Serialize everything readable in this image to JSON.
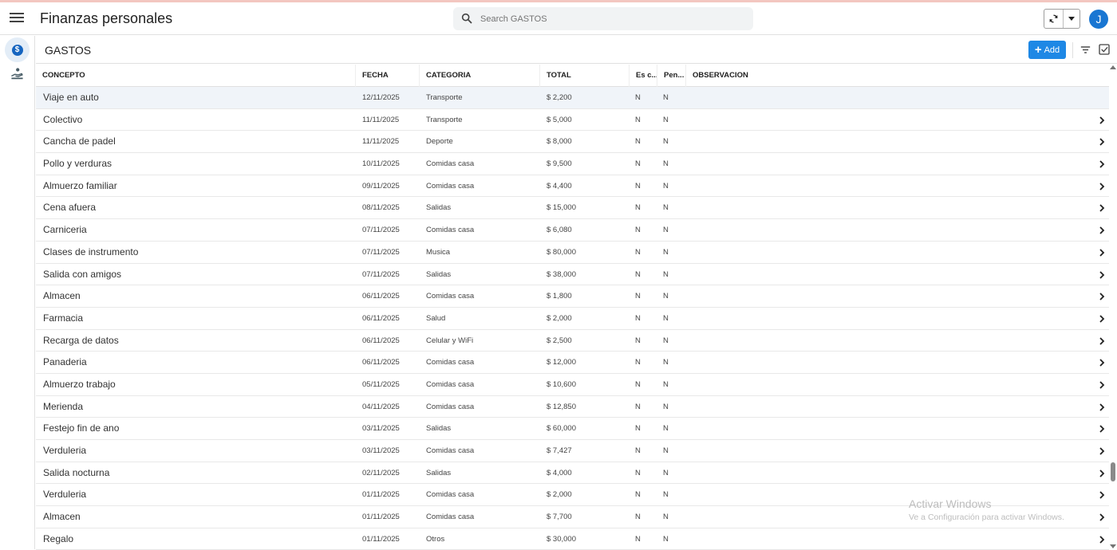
{
  "app": {
    "title": "Finanzas personales",
    "avatar_initial": "J"
  },
  "search": {
    "placeholder": "Search GASTOS"
  },
  "view": {
    "title": "GASTOS",
    "add_label": "Add"
  },
  "columns": [
    "CONCEPTO",
    "FECHA",
    "CATEGORIA",
    "TOTAL",
    "Es c...",
    "Pen...",
    "OBSERVACION"
  ],
  "rows": [
    {
      "concepto": "Viaje en auto",
      "fecha": "12/11/2025",
      "categoria": "Transporte",
      "total": "$ 2,200",
      "es": "N",
      "pen": "N"
    },
    {
      "concepto": "Colectivo",
      "fecha": "11/11/2025",
      "categoria": "Transporte",
      "total": "$ 5,000",
      "es": "N",
      "pen": "N"
    },
    {
      "concepto": "Cancha de padel",
      "fecha": "11/11/2025",
      "categoria": "Deporte",
      "total": "$ 8,000",
      "es": "N",
      "pen": "N"
    },
    {
      "concepto": "Pollo y verduras",
      "fecha": "10/11/2025",
      "categoria": "Comidas casa",
      "total": "$ 9,500",
      "es": "N",
      "pen": "N"
    },
    {
      "concepto": "Almuerzo familiar",
      "fecha": "09/11/2025",
      "categoria": "Comidas casa",
      "total": "$ 4,400",
      "es": "N",
      "pen": "N"
    },
    {
      "concepto": "Cena afuera",
      "fecha": "08/11/2025",
      "categoria": "Salidas",
      "total": "$ 15,000",
      "es": "N",
      "pen": "N"
    },
    {
      "concepto": "Carniceria",
      "fecha": "07/11/2025",
      "categoria": "Comidas casa",
      "total": "$ 6,080",
      "es": "N",
      "pen": "N"
    },
    {
      "concepto": "Clases de instrumento",
      "fecha": "07/11/2025",
      "categoria": "Musica",
      "total": "$ 80,000",
      "es": "N",
      "pen": "N"
    },
    {
      "concepto": "Salida con amigos",
      "fecha": "07/11/2025",
      "categoria": "Salidas",
      "total": "$ 38,000",
      "es": "N",
      "pen": "N"
    },
    {
      "concepto": "Almacen",
      "fecha": "06/11/2025",
      "categoria": "Comidas casa",
      "total": "$ 1,800",
      "es": "N",
      "pen": "N"
    },
    {
      "concepto": "Farmacia",
      "fecha": "06/11/2025",
      "categoria": "Salud",
      "total": "$ 2,000",
      "es": "N",
      "pen": "N"
    },
    {
      "concepto": "Recarga de datos",
      "fecha": "06/11/2025",
      "categoria": "Celular y WiFi",
      "total": "$ 2,500",
      "es": "N",
      "pen": "N"
    },
    {
      "concepto": "Panaderia",
      "fecha": "06/11/2025",
      "categoria": "Comidas casa",
      "total": "$ 12,000",
      "es": "N",
      "pen": "N"
    },
    {
      "concepto": "Almuerzo trabajo",
      "fecha": "05/11/2025",
      "categoria": "Comidas casa",
      "total": "$ 10,600",
      "es": "N",
      "pen": "N"
    },
    {
      "concepto": "Merienda",
      "fecha": "04/11/2025",
      "categoria": "Comidas casa",
      "total": "$ 12,850",
      "es": "N",
      "pen": "N"
    },
    {
      "concepto": "Festejo fin de ano",
      "fecha": "03/11/2025",
      "categoria": "Salidas",
      "total": "$ 60,000",
      "es": "N",
      "pen": "N"
    },
    {
      "concepto": "Verduleria",
      "fecha": "03/11/2025",
      "categoria": "Comidas casa",
      "total": "$ 7,427",
      "es": "N",
      "pen": "N"
    },
    {
      "concepto": "Salida nocturna",
      "fecha": "02/11/2025",
      "categoria": "Salidas",
      "total": "$ 4,000",
      "es": "N",
      "pen": "N"
    },
    {
      "concepto": "Verduleria",
      "fecha": "01/11/2025",
      "categoria": "Comidas casa",
      "total": "$ 2,000",
      "es": "N",
      "pen": "N"
    },
    {
      "concepto": "Almacen",
      "fecha": "01/11/2025",
      "categoria": "Comidas casa",
      "total": "$ 7,700",
      "es": "N",
      "pen": "N"
    },
    {
      "concepto": "Regalo",
      "fecha": "01/11/2025",
      "categoria": "Otros",
      "total": "$ 30,000",
      "es": "N",
      "pen": "N"
    }
  ],
  "watermark": {
    "line1": "Activar Windows",
    "line2": "Ve a Configuración para activar Windows."
  },
  "colors": {
    "accent": "#1e88e5",
    "avatar": "#1976d2",
    "highlight_row": "#f0f4f9"
  },
  "icons": {
    "menu": "hamburger-icon",
    "search": "search-icon",
    "sync": "sync-icon",
    "dropdown": "caret-down-icon",
    "nav_money": "dollar-circle-icon",
    "nav_hand": "hand-coin-icon",
    "filter": "filter-icon",
    "select": "checkbox-icon",
    "row": "chevron-right-icon"
  }
}
